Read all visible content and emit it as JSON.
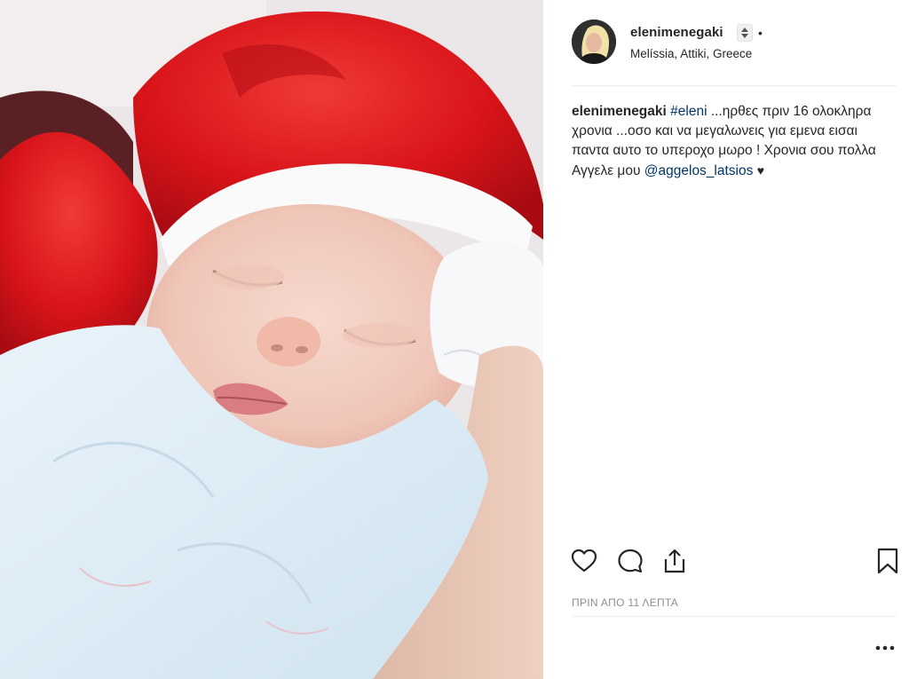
{
  "post": {
    "username": "elenimenegaki",
    "separator": "•",
    "location": "Melíssia, Attiki, Greece",
    "caption": {
      "username": "elenimenegaki",
      "hashtag": "#eleni",
      "text": " ...ηρθες πριν 16 ολοκληρα χρονια ...οσο και να μεγαλωνεις για εμενα εισαι παντα αυτο το υπεροχο μωρο ! Χρονια σου πολλα Αγγελε μου ",
      "mention": "@aggelos_latsios",
      "emoji": "♥"
    },
    "timestamp": "ΠΡΙΝ ΑΠΟ 11 ΛΕΠΤΑ"
  },
  "icons": {
    "like": "heart-outline-icon",
    "comment": "comment-bubble-icon",
    "share": "share-upload-icon",
    "save": "bookmark-icon",
    "more": "ellipsis-icon"
  },
  "colors": {
    "link": "#003569",
    "muted": "#8e8e8e",
    "text": "#262626",
    "hat_red": "#d8141a"
  }
}
